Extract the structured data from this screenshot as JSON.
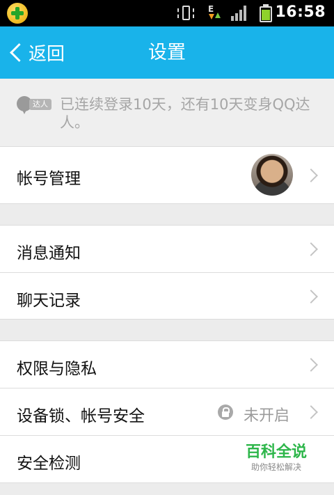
{
  "status_bar": {
    "time": "16:58",
    "network_type": "E",
    "icons": [
      "360-security-icon",
      "vibrate-icon",
      "data-arrows-icon",
      "signal-icon",
      "battery-icon"
    ]
  },
  "header": {
    "back_label": "返回",
    "title": "设置",
    "color": "#19b3ea"
  },
  "notice": {
    "badge_tag": "达人",
    "text": "已连续登录10天，还有10天变身QQ达人。"
  },
  "rows": {
    "account": {
      "label": "帐号管理"
    },
    "notifications": {
      "label": "消息通知"
    },
    "chat_history": {
      "label": "聊天记录"
    },
    "privacy": {
      "label": "权限与隐私"
    },
    "device_lock": {
      "label": "设备锁、帐号安全",
      "status": "未开启"
    },
    "security_check": {
      "label": "安全检测"
    }
  },
  "watermark": {
    "title": "百科全说",
    "subtitle": "助你轻松解决"
  }
}
